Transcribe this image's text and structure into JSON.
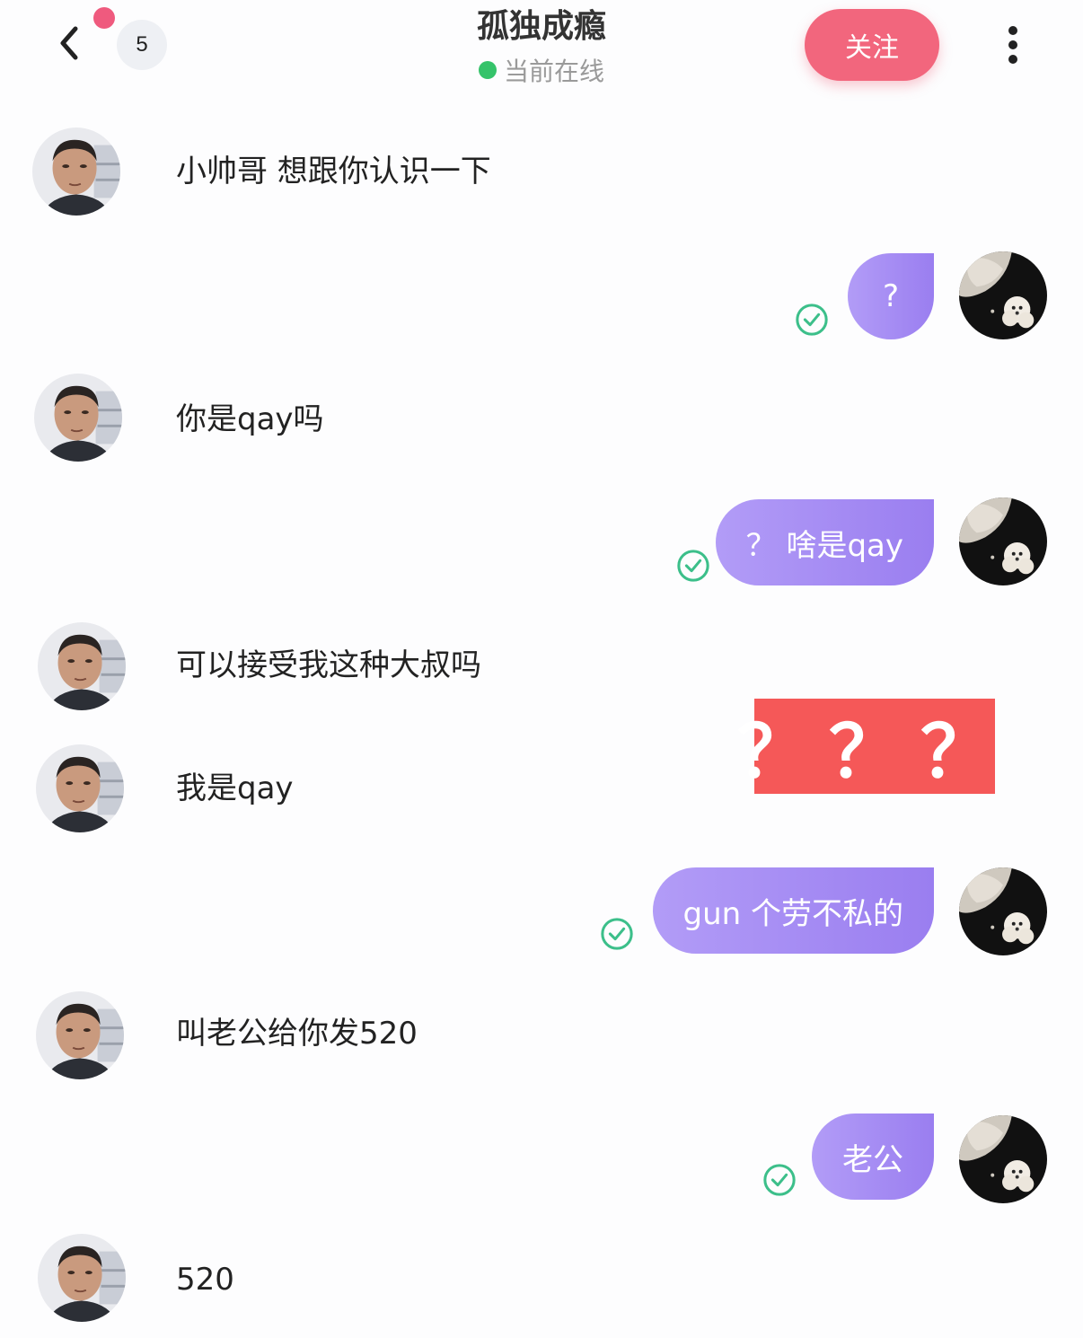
{
  "header": {
    "unread_count": "5",
    "title": "孤独成瘾",
    "status": "当前在线",
    "follow_label": "关注"
  },
  "colors": {
    "outgoing_bubble": "#a58bf4",
    "follow_button": "#f2667d",
    "online_dot": "#35c36a",
    "read_check": "#3cbf8a",
    "sticker_bg": "#f55858"
  },
  "messages": [
    {
      "from": "other",
      "text": "小帅哥 想跟你认识一下"
    },
    {
      "from": "me",
      "text": "?",
      "read": true
    },
    {
      "from": "other",
      "text": "你是qay吗"
    },
    {
      "from": "me",
      "text": "？ 啥是qay",
      "read": true
    },
    {
      "from": "other",
      "text": "可以接受我这种大叔吗"
    },
    {
      "from": "me",
      "text": "？？？",
      "type": "sticker"
    },
    {
      "from": "other",
      "text": "我是qay"
    },
    {
      "from": "me",
      "text": "gun 个劳不私的",
      "read": true
    },
    {
      "from": "other",
      "text": "叫老公给你发520"
    },
    {
      "from": "me",
      "text": "老公",
      "read": true
    },
    {
      "from": "other",
      "text": "520"
    }
  ]
}
